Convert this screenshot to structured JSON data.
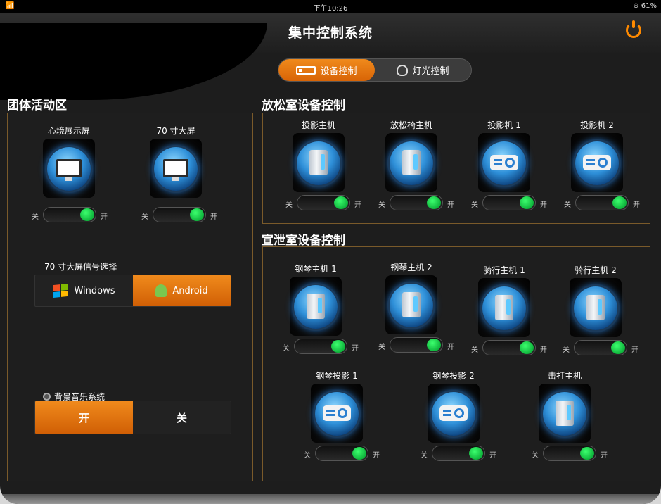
{
  "status_bar": {
    "time": "下午10:26",
    "left": "📶",
    "battery": "⊕ 61%"
  },
  "header": {
    "title": "集中控制系统",
    "power_icon": "power-icon",
    "accent": "#ff8a00"
  },
  "tabs": [
    {
      "label": "设备控制",
      "icon": "device-icon",
      "active": true
    },
    {
      "label": "灯光控制",
      "icon": "bulb-icon",
      "active": false
    }
  ],
  "group_area": {
    "title": "团体活动区",
    "devices": [
      {
        "label": "心境展示屏",
        "icon": "monitor-icon",
        "off": "关",
        "on": "开"
      },
      {
        "label": "70 寸大屏",
        "icon": "monitor-icon",
        "off": "关",
        "on": "开"
      }
    ],
    "signal": {
      "title": "70 寸大屏信号选择",
      "options": [
        {
          "label": "Windows",
          "selected": false
        },
        {
          "label": "Android",
          "selected": true
        }
      ]
    },
    "music": {
      "title": "背景音乐系统",
      "options": [
        {
          "label": "开",
          "selected": true
        },
        {
          "label": "关",
          "selected": false
        }
      ]
    }
  },
  "relax_room": {
    "title": "放松室设备控制",
    "devices": [
      {
        "label": "投影主机",
        "icon": "server-icon",
        "off": "关",
        "on": "开"
      },
      {
        "label": "放松椅主机",
        "icon": "server-icon",
        "off": "关",
        "on": "开"
      },
      {
        "label": "投影机 1",
        "icon": "projector-icon",
        "off": "关",
        "on": "开"
      },
      {
        "label": "投影机 2",
        "icon": "projector-icon",
        "off": "关",
        "on": "开"
      }
    ]
  },
  "vent_room": {
    "title": "宣泄室设备控制",
    "devices": [
      {
        "label": "钢琴主机 1",
        "icon": "server-icon",
        "off": "关",
        "on": "开"
      },
      {
        "label": "钢琴主机 2",
        "icon": "server-icon",
        "off": "关",
        "on": "开"
      },
      {
        "label": "骑行主机 1",
        "icon": "server-icon",
        "off": "关",
        "on": "开"
      },
      {
        "label": "骑行主机 2",
        "icon": "server-icon",
        "off": "关",
        "on": "开"
      },
      {
        "label": "钢琴投影 1",
        "icon": "projector-icon",
        "off": "关",
        "on": "开"
      },
      {
        "label": "钢琴投影 2",
        "icon": "projector-icon",
        "off": "关",
        "on": "开"
      },
      {
        "label": "击打主机",
        "icon": "server-icon",
        "off": "关",
        "on": "开"
      }
    ]
  }
}
